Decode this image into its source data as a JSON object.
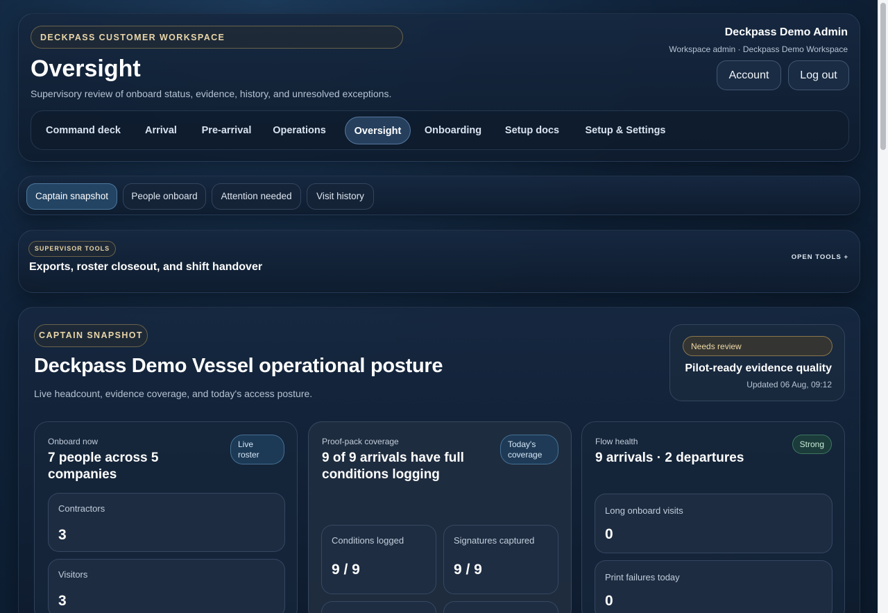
{
  "header": {
    "eyebrow": "DECKPASS CUSTOMER WORKSPACE",
    "title": "Oversight",
    "subtitle": "Supervisory review of onboard status, evidence, history, and unresolved exceptions.",
    "user_name": "Deckpass Demo Admin",
    "user_role": "Workspace admin · Deckpass Demo Workspace",
    "account_label": "Account",
    "logout_label": "Log out"
  },
  "nav": {
    "items": [
      "Command deck",
      "Arrival",
      "Pre-arrival",
      "Operations",
      "Oversight",
      "Onboarding",
      "Setup docs",
      "Setup & Settings"
    ],
    "active": "Oversight"
  },
  "subtabs": {
    "items": [
      "Captain snapshot",
      "People onboard",
      "Attention needed",
      "Visit history"
    ],
    "active": "Captain snapshot"
  },
  "tools": {
    "badge": "SUPERVISOR TOOLS",
    "title": "Exports, roster closeout, and shift handover",
    "open_label": "OPEN TOOLS +"
  },
  "snapshot": {
    "badge": "CAPTAIN SNAPSHOT",
    "title": "Deckpass Demo Vessel operational posture",
    "subtitle": "Live headcount, evidence coverage, and today's access posture.",
    "review": {
      "pill": "Needs review",
      "title": "Pilot-ready evidence quality",
      "updated": "Updated 06 Aug, 09:12"
    },
    "cards": [
      {
        "label": "Onboard now",
        "title": "7 people across 5 companies",
        "tag": "Live roster",
        "boxes": [
          {
            "label": "Contractors",
            "value": "3"
          },
          {
            "label": "Visitors",
            "value": "3"
          }
        ]
      },
      {
        "label": "Proof-pack coverage",
        "title": "9 of 9 arrivals have full conditions logging",
        "tag": "Today's coverage",
        "boxes": [
          {
            "label": "Conditions logged",
            "value": "9 / 9"
          },
          {
            "label": "Signatures captured",
            "value": "9 / 9"
          }
        ]
      },
      {
        "label": "Flow health",
        "title": "9 arrivals · 2 departures",
        "tag": "Strong",
        "boxes": [
          {
            "label": "Long onboard visits",
            "value": "0"
          },
          {
            "label": "Print failures today",
            "value": "0"
          }
        ]
      }
    ]
  },
  "colors": {
    "background": "#10233a",
    "accent_gold": "#e9d6a8",
    "active_blue": "#2d4b6e",
    "strong_green": "#1e463a"
  }
}
